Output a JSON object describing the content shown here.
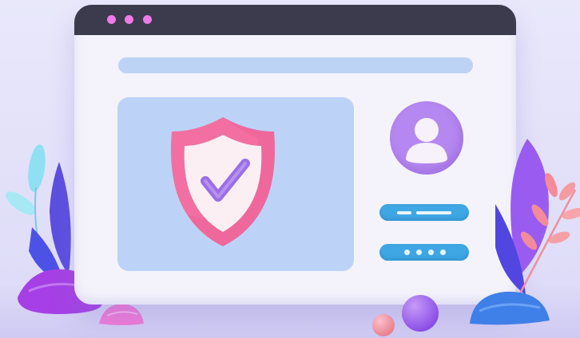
{
  "window": {
    "control_dots": [
      "close-dot",
      "minimize-dot",
      "maximize-dot"
    ],
    "dot_color": "#f07be8",
    "titlebar_color": "#3b3b4d"
  },
  "address_bar": {
    "color": "#bdd3f6"
  },
  "content_panel": {
    "color": "#bcd3f7",
    "icon": "shield-check-icon"
  },
  "profile": {
    "icon": "user-avatar-icon",
    "color": "#b587f0"
  },
  "login_form": {
    "username_field": {
      "color": "#3fa8e4",
      "value": ""
    },
    "password_field": {
      "color": "#3fa8e4",
      "masked_char_count": 4
    }
  },
  "palette": {
    "shield_pink": "#f36fa1",
    "shield_inner": "#fbeff4",
    "check_purple": "#9b6ee6"
  }
}
